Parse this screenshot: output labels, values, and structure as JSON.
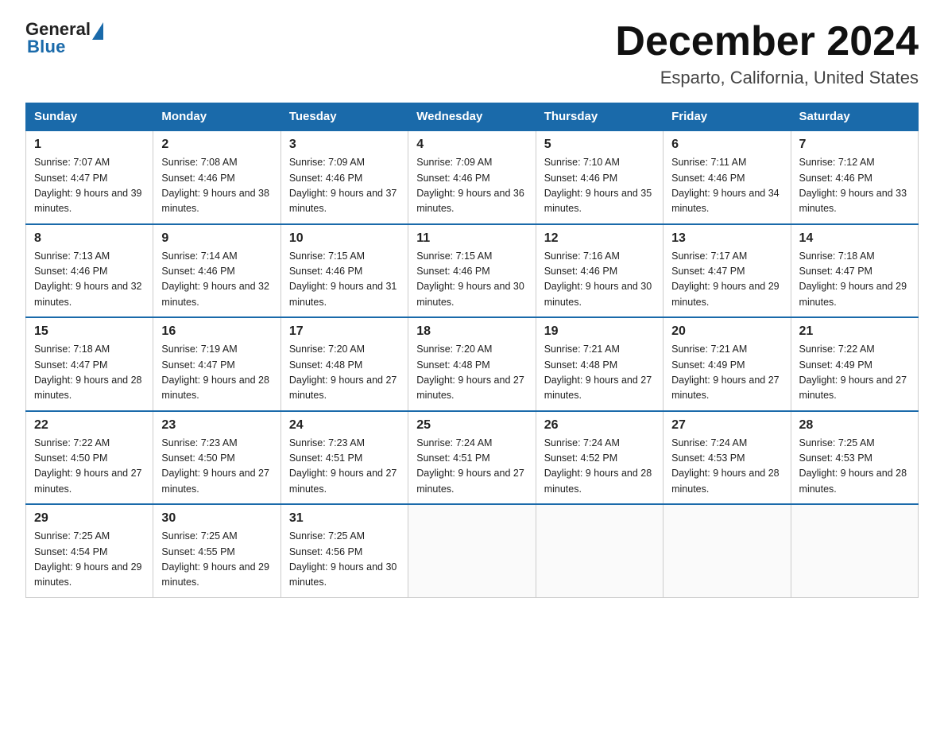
{
  "header": {
    "logo_general": "General",
    "logo_blue": "Blue",
    "month_title": "December 2024",
    "subtitle": "Esparto, California, United States"
  },
  "days_of_week": [
    "Sunday",
    "Monday",
    "Tuesday",
    "Wednesday",
    "Thursday",
    "Friday",
    "Saturday"
  ],
  "weeks": [
    [
      {
        "day": "1",
        "sunrise": "7:07 AM",
        "sunset": "4:47 PM",
        "daylight": "9 hours and 39 minutes."
      },
      {
        "day": "2",
        "sunrise": "7:08 AM",
        "sunset": "4:46 PM",
        "daylight": "9 hours and 38 minutes."
      },
      {
        "day": "3",
        "sunrise": "7:09 AM",
        "sunset": "4:46 PM",
        "daylight": "9 hours and 37 minutes."
      },
      {
        "day": "4",
        "sunrise": "7:09 AM",
        "sunset": "4:46 PM",
        "daylight": "9 hours and 36 minutes."
      },
      {
        "day": "5",
        "sunrise": "7:10 AM",
        "sunset": "4:46 PM",
        "daylight": "9 hours and 35 minutes."
      },
      {
        "day": "6",
        "sunrise": "7:11 AM",
        "sunset": "4:46 PM",
        "daylight": "9 hours and 34 minutes."
      },
      {
        "day": "7",
        "sunrise": "7:12 AM",
        "sunset": "4:46 PM",
        "daylight": "9 hours and 33 minutes."
      }
    ],
    [
      {
        "day": "8",
        "sunrise": "7:13 AM",
        "sunset": "4:46 PM",
        "daylight": "9 hours and 32 minutes."
      },
      {
        "day": "9",
        "sunrise": "7:14 AM",
        "sunset": "4:46 PM",
        "daylight": "9 hours and 32 minutes."
      },
      {
        "day": "10",
        "sunrise": "7:15 AM",
        "sunset": "4:46 PM",
        "daylight": "9 hours and 31 minutes."
      },
      {
        "day": "11",
        "sunrise": "7:15 AM",
        "sunset": "4:46 PM",
        "daylight": "9 hours and 30 minutes."
      },
      {
        "day": "12",
        "sunrise": "7:16 AM",
        "sunset": "4:46 PM",
        "daylight": "9 hours and 30 minutes."
      },
      {
        "day": "13",
        "sunrise": "7:17 AM",
        "sunset": "4:47 PM",
        "daylight": "9 hours and 29 minutes."
      },
      {
        "day": "14",
        "sunrise": "7:18 AM",
        "sunset": "4:47 PM",
        "daylight": "9 hours and 29 minutes."
      }
    ],
    [
      {
        "day": "15",
        "sunrise": "7:18 AM",
        "sunset": "4:47 PM",
        "daylight": "9 hours and 28 minutes."
      },
      {
        "day": "16",
        "sunrise": "7:19 AM",
        "sunset": "4:47 PM",
        "daylight": "9 hours and 28 minutes."
      },
      {
        "day": "17",
        "sunrise": "7:20 AM",
        "sunset": "4:48 PM",
        "daylight": "9 hours and 27 minutes."
      },
      {
        "day": "18",
        "sunrise": "7:20 AM",
        "sunset": "4:48 PM",
        "daylight": "9 hours and 27 minutes."
      },
      {
        "day": "19",
        "sunrise": "7:21 AM",
        "sunset": "4:48 PM",
        "daylight": "9 hours and 27 minutes."
      },
      {
        "day": "20",
        "sunrise": "7:21 AM",
        "sunset": "4:49 PM",
        "daylight": "9 hours and 27 minutes."
      },
      {
        "day": "21",
        "sunrise": "7:22 AM",
        "sunset": "4:49 PM",
        "daylight": "9 hours and 27 minutes."
      }
    ],
    [
      {
        "day": "22",
        "sunrise": "7:22 AM",
        "sunset": "4:50 PM",
        "daylight": "9 hours and 27 minutes."
      },
      {
        "day": "23",
        "sunrise": "7:23 AM",
        "sunset": "4:50 PM",
        "daylight": "9 hours and 27 minutes."
      },
      {
        "day": "24",
        "sunrise": "7:23 AM",
        "sunset": "4:51 PM",
        "daylight": "9 hours and 27 minutes."
      },
      {
        "day": "25",
        "sunrise": "7:24 AM",
        "sunset": "4:51 PM",
        "daylight": "9 hours and 27 minutes."
      },
      {
        "day": "26",
        "sunrise": "7:24 AM",
        "sunset": "4:52 PM",
        "daylight": "9 hours and 28 minutes."
      },
      {
        "day": "27",
        "sunrise": "7:24 AM",
        "sunset": "4:53 PM",
        "daylight": "9 hours and 28 minutes."
      },
      {
        "day": "28",
        "sunrise": "7:25 AM",
        "sunset": "4:53 PM",
        "daylight": "9 hours and 28 minutes."
      }
    ],
    [
      {
        "day": "29",
        "sunrise": "7:25 AM",
        "sunset": "4:54 PM",
        "daylight": "9 hours and 29 minutes."
      },
      {
        "day": "30",
        "sunrise": "7:25 AM",
        "sunset": "4:55 PM",
        "daylight": "9 hours and 29 minutes."
      },
      {
        "day": "31",
        "sunrise": "7:25 AM",
        "sunset": "4:56 PM",
        "daylight": "9 hours and 30 minutes."
      },
      null,
      null,
      null,
      null
    ]
  ]
}
